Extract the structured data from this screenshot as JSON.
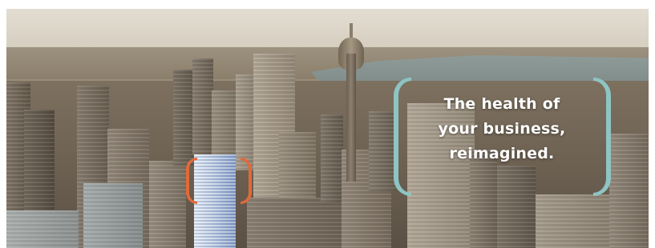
{
  "banner": {
    "tagline_lines": [
      "The health of",
      "your business,",
      "reimagined."
    ]
  },
  "colors": {
    "accent_teal": "#8ec5c4",
    "accent_orange": "#e06a3a",
    "tagline_text": "#ffffff"
  }
}
